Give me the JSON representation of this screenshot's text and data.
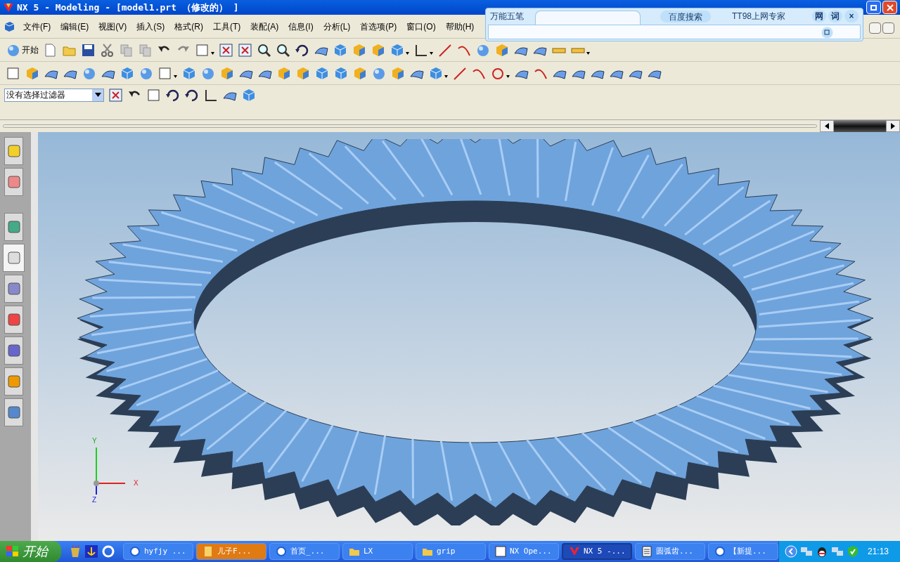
{
  "window": {
    "title": "NX 5 - Modeling - [model1.prt （修改的） ]"
  },
  "menu": [
    "文件(F)",
    "编辑(E)",
    "视图(V)",
    "插入(S)",
    "格式(R)",
    "工具(T)",
    "装配(A)",
    "信息(I)",
    "分析(L)",
    "首选项(P)",
    "窗口(O)",
    "帮助(H)"
  ],
  "ime_bar": {
    "name": "万能五笔",
    "search_button": "百度搜索",
    "expert_label": "TT98上网专家",
    "word_buttons": [
      "网",
      "词"
    ],
    "close": "×"
  },
  "toolbar": {
    "start_label": "开始"
  },
  "selection_filter": {
    "value": "没有选择过滤器"
  },
  "axes": [
    "Y",
    "X",
    "Z"
  ],
  "resource_tabs": [
    {
      "selected": false
    },
    {
      "selected": false
    },
    {
      "selected": false
    },
    {
      "selected": true
    },
    {
      "selected": false
    },
    {
      "selected": false
    },
    {
      "selected": false
    },
    {
      "selected": false
    },
    {
      "selected": false
    }
  ],
  "taskbar": {
    "start": "开始",
    "items": [
      {
        "label": "hyfjy ...",
        "kind": "browser",
        "selected": false,
        "flashing": false
      },
      {
        "label": "儿子F...",
        "kind": "note",
        "selected": false,
        "flashing": true
      },
      {
        "label": "首页_...",
        "kind": "browser",
        "selected": false,
        "flashing": false
      },
      {
        "label": "LX",
        "kind": "folder",
        "selected": false,
        "flashing": false
      },
      {
        "label": "grip",
        "kind": "folder",
        "selected": false,
        "flashing": false
      },
      {
        "label": "NX Ope...",
        "kind": "binary",
        "selected": false,
        "flashing": false
      },
      {
        "label": "NX 5 -...",
        "kind": "nx",
        "selected": true,
        "flashing": false
      },
      {
        "label": "圆弧齿...",
        "kind": "notepad",
        "selected": false,
        "flashing": false
      },
      {
        "label": "【新提...",
        "kind": "browser",
        "selected": false,
        "flashing": false
      }
    ],
    "clock": "21:13"
  }
}
